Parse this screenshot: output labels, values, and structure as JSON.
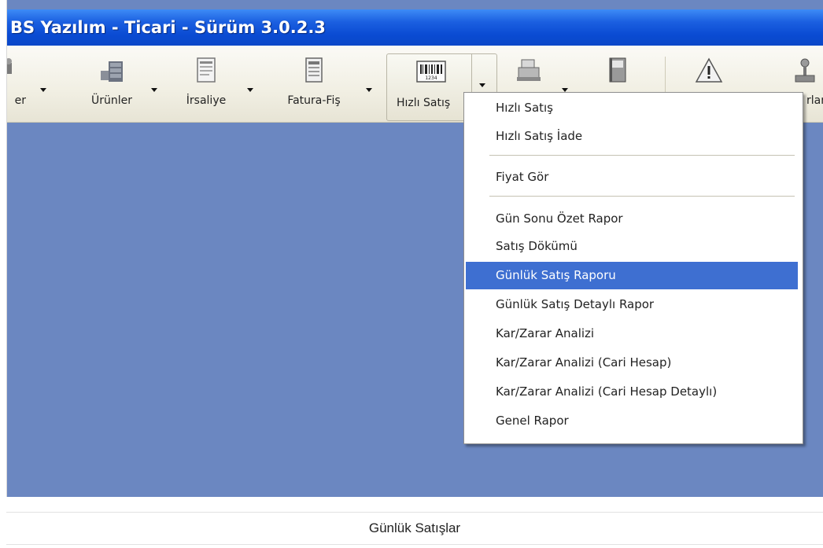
{
  "window": {
    "title": "BS Yazılım - Ticari - Sürüm 3.0.2.3"
  },
  "toolbar": {
    "items": [
      {
        "label": "er",
        "icon": "users-icon"
      },
      {
        "label": "Ürünler",
        "icon": "products-icon"
      },
      {
        "label": "İrsaliye",
        "icon": "waybill-icon"
      },
      {
        "label": "Fatura-Fiş",
        "icon": "invoice-icon"
      },
      {
        "label": "Hızlı Satış",
        "icon": "barcode-icon"
      },
      {
        "label": "",
        "icon": "cash-register-icon"
      },
      {
        "label": "",
        "icon": "notebook-icon"
      },
      {
        "label": "",
        "icon": "warning-icon"
      },
      {
        "label": "rlar",
        "icon": "joystick-icon"
      }
    ]
  },
  "menu": {
    "items": [
      "Hızlı Satış",
      "Hızlı Satış İade",
      "Fiyat Gör",
      "Gün Sonu Özet Rapor",
      "Satış Dökümü",
      "Günlük Satış Raporu",
      "Günlük Satış Detaylı Rapor",
      "Kar/Zarar Analizi",
      "Kar/Zarar Analizi (Cari Hesap)",
      "Kar/Zarar Analizi (Cari Hesap Detaylı)",
      "Genel Rapor"
    ],
    "selected": "Günlük Satış Raporu"
  },
  "caption": "Günlük Satışlar",
  "colors": {
    "titlebar": "#0a4bd3",
    "desktop": "#6b87c1",
    "selection": "#3e6fd1"
  }
}
